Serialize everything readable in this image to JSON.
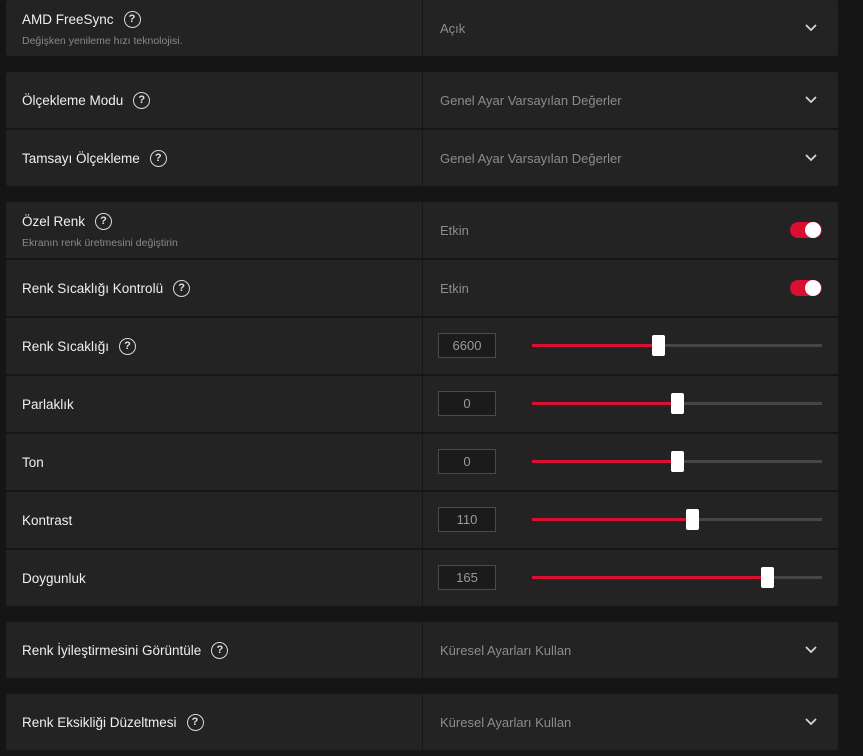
{
  "freesync": {
    "label": "AMD FreeSync",
    "description": "Değişken yenileme hızı teknolojisi.",
    "value": "Açık"
  },
  "scaling": {
    "mode_label": "Ölçekleme Modu",
    "mode_value": "Genel Ayar Varsayılan Değerler",
    "integer_label": "Tamsayı Ölçekleme",
    "integer_value": "Genel Ayar Varsayılan Değerler"
  },
  "custom_color": {
    "label": "Özel Renk",
    "description": "Ekranın renk üretmesini değiştirin",
    "value": "Etkin",
    "enabled": true
  },
  "temp_control": {
    "label": "Renk Sıcaklığı Kontrolü",
    "value": "Etkin",
    "enabled": true
  },
  "sliders": [
    {
      "label": "Renk Sıcaklığı",
      "value": "6600",
      "fraction": 0.435,
      "help": true
    },
    {
      "label": "Parlaklık",
      "value": "0",
      "fraction": 0.5,
      "help": false
    },
    {
      "label": "Ton",
      "value": "0",
      "fraction": 0.5,
      "help": false
    },
    {
      "label": "Kontrast",
      "value": "110",
      "fraction": 0.55,
      "help": false
    },
    {
      "label": "Doygunluk",
      "value": "165",
      "fraction": 0.81,
      "help": false
    }
  ],
  "enhancement": {
    "label": "Renk İyileştirmesini Görüntüle",
    "value": "Küresel Ayarları Kullan"
  },
  "deficiency": {
    "label": "Renk Eksikliği Düzeltmesi",
    "value": "Küresel Ayarları Kullan"
  },
  "icons": {
    "help": "help-circle-icon",
    "dropdown": "chevron-down-icon"
  },
  "colors": {
    "accent": "#d80f31",
    "background": "#151515",
    "panel": "#232323"
  }
}
